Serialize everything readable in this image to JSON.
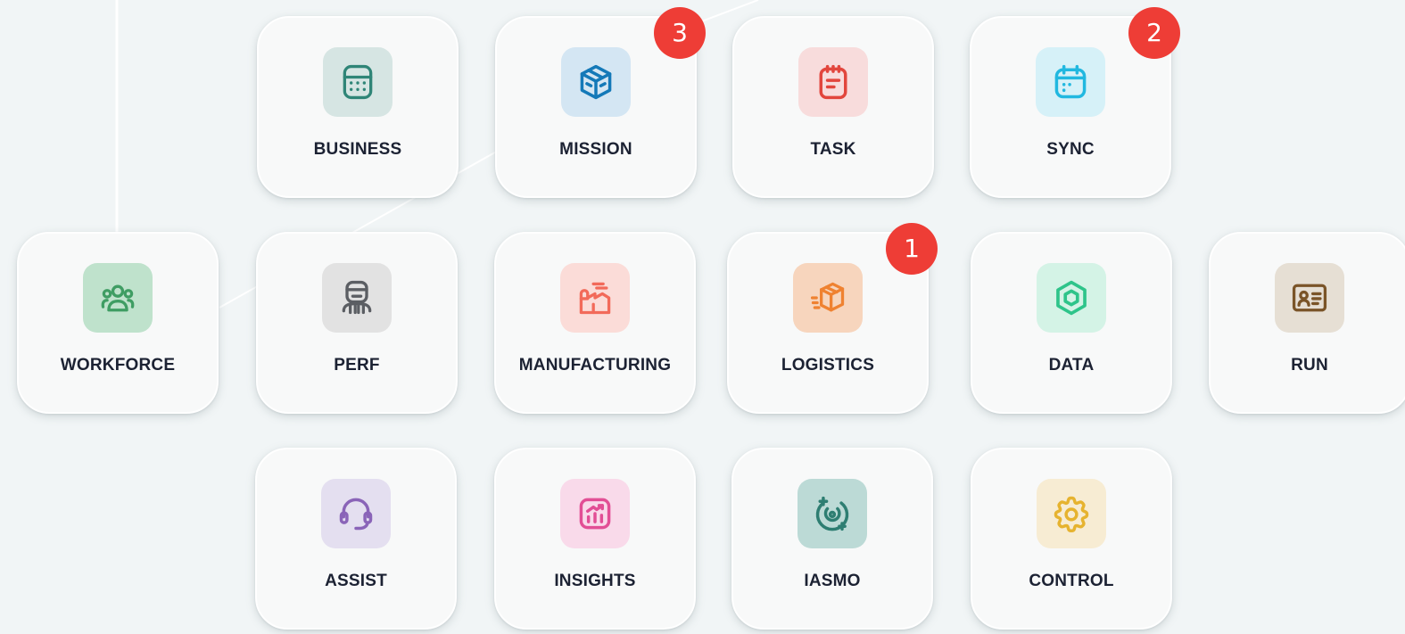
{
  "tiles": [
    {
      "key": "business",
      "label": "BUSINESS",
      "icon": "calculator-icon",
      "bg": "#d6e5e3",
      "fg": "#2f8577",
      "badge": null
    },
    {
      "key": "mission",
      "label": "MISSION",
      "icon": "cube-icon",
      "bg": "#d4e6f3",
      "fg": "#1479b8",
      "badge": "3"
    },
    {
      "key": "task",
      "label": "TASK",
      "icon": "notepad-icon",
      "bg": "#f8dcdc",
      "fg": "#e2463d",
      "badge": null
    },
    {
      "key": "sync",
      "label": "SYNC",
      "icon": "calendar-icon",
      "bg": "#d6f1f8",
      "fg": "#21b8e0",
      "badge": "2"
    },
    {
      "key": "workforce",
      "label": "WORKFORCE",
      "icon": "users-icon",
      "bg": "#bfe2cc",
      "fg": "#3f9d63",
      "badge": null
    },
    {
      "key": "perf",
      "label": "PERF",
      "icon": "robot-icon",
      "bg": "#e2e2e2",
      "fg": "#5b5e63",
      "badge": null
    },
    {
      "key": "manufacturing",
      "label": "MANUFACTURING",
      "icon": "factory-icon",
      "bg": "#fbdcd8",
      "fg": "#f26a5a",
      "badge": null
    },
    {
      "key": "logistics",
      "label": "LOGISTICS",
      "icon": "package-icon",
      "bg": "#f7d5bd",
      "fg": "#ef8231",
      "badge": "1"
    },
    {
      "key": "data",
      "label": "DATA",
      "icon": "hexagon-icon",
      "bg": "#d4f3e6",
      "fg": "#2ec48a",
      "badge": null
    },
    {
      "key": "run",
      "label": "RUN",
      "icon": "id-card-icon",
      "bg": "#e6dfd4",
      "fg": "#7a5428",
      "badge": null
    },
    {
      "key": "assist",
      "label": "ASSIST",
      "icon": "headset-icon",
      "bg": "#e4dff0",
      "fg": "#8a64b8",
      "badge": null
    },
    {
      "key": "insights",
      "label": "INSIGHTS",
      "icon": "chart-icon",
      "bg": "#f9daea",
      "fg": "#e24f95",
      "badge": null
    },
    {
      "key": "iasmo",
      "label": "IASMO",
      "icon": "orbit-icon",
      "bg": "#bcdad6",
      "fg": "#2e7e72",
      "badge": null
    },
    {
      "key": "control",
      "label": "CONTROL",
      "icon": "gear-icon",
      "bg": "#f7ecd3",
      "fg": "#e6b32f",
      "badge": null
    }
  ]
}
